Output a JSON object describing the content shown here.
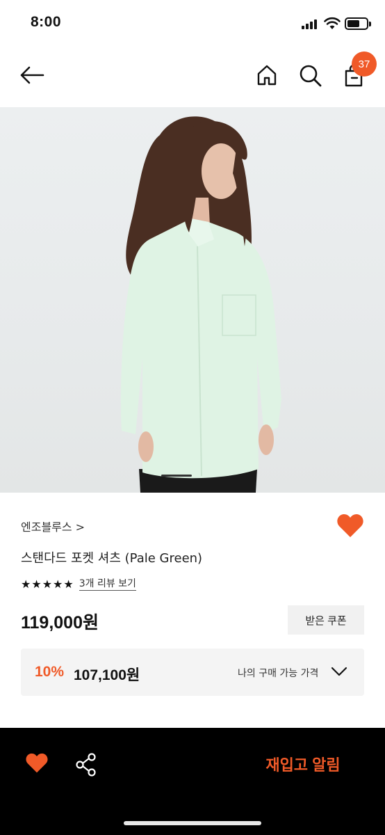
{
  "status_bar": {
    "time": "8:00"
  },
  "nav": {
    "back_icon": "arrow-left",
    "home_icon": "home",
    "search_icon": "search",
    "cart_icon": "shopping-bag",
    "cart_count": "37"
  },
  "product": {
    "image": {
      "subject": "model in pale green oversized shirt",
      "bg": "#e8ebec"
    },
    "slide_indicator_color": "#333333",
    "brand": "엔조블루스 >",
    "title": "스탠다드 포켓 셔츠 (Pale Green)",
    "rating_stars": 5,
    "review_link": "3개 리뷰 보기",
    "price": "119,000원",
    "coupon_button": "받은 쿠폰",
    "discount": {
      "rate": "10%",
      "price": "107,100원",
      "label": "나의 구매 가능 가격"
    }
  },
  "bottom_bar": {
    "wish_icon": "heart",
    "share_icon": "share",
    "restock_button": "재입고 알림"
  },
  "colors": {
    "accent": "#f05a28",
    "bottom_bar_bg": "#000000",
    "discount_box_bg": "#f4f4f4",
    "coupon_bg": "#f1f1f1"
  }
}
